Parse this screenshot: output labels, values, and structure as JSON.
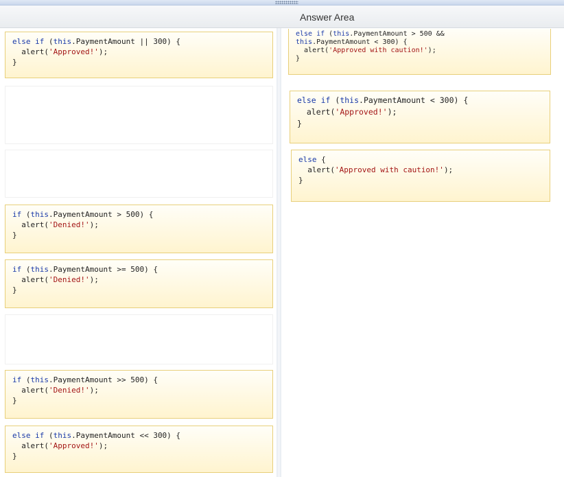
{
  "header": {
    "answer_area_title": "Answer Area"
  },
  "source_tiles": [
    {
      "l1_kw": "else if",
      "l1_pre": " (",
      "l1_this": "this",
      "l1_rest": ".PaymentAmount || 300) {",
      "l2_pre": "  alert(",
      "l2_str": "'Approved!'",
      "l2_post": ");",
      "l3": "}"
    },
    {
      "l1_kw": "if",
      "l1_pre": " (",
      "l1_this": "this",
      "l1_rest": ".PaymentAmount > 500) {",
      "l2_pre": "  alert(",
      "l2_str": "'Denied!'",
      "l2_post": ");",
      "l3": "}"
    },
    {
      "l1_kw": "if",
      "l1_pre": " (",
      "l1_this": "this",
      "l1_rest": ".PaymentAmount >= 500) {",
      "l2_pre": "  alert(",
      "l2_str": "'Denied!'",
      "l2_post": ");",
      "l3": "}"
    },
    {
      "l1_kw": "if",
      "l1_pre": " (",
      "l1_this": "this",
      "l1_rest": ".PaymentAmount >> 500) {",
      "l2_pre": "  alert(",
      "l2_str": "'Denied!'",
      "l2_post": ");",
      "l3": "}"
    },
    {
      "l1_kw": "else if",
      "l1_pre": " (",
      "l1_this": "this",
      "l1_rest": ".PaymentAmount << 300) {",
      "l2_pre": "  alert(",
      "l2_str": "'Approved!'",
      "l2_post": ");",
      "l3": "}"
    }
  ],
  "answer_tiles": [
    {
      "l1_kw": "else if",
      "l1_pre": " (",
      "l1_this": "this",
      "l1_rest": ".PaymentAmount > 500 &&",
      "l2_this": "this",
      "l2_rest": ".PaymentAmount < 300) {",
      "l3_pre": "  alert(",
      "l3_str": "'Approved with caution!'",
      "l3_post": ");",
      "l4": "}"
    },
    {
      "l1_kw": "else if",
      "l1_pre": " (",
      "l1_this": "this",
      "l1_rest": ".PaymentAmount < 300) {",
      "l2_pre": "  alert(",
      "l2_str": "'Approved!'",
      "l2_post": ");",
      "l3": "}"
    },
    {
      "l1_kw": "else",
      "l1_rest": " {",
      "l2_pre": "  alert(",
      "l2_str": "'Approved with caution!'",
      "l2_post": ");",
      "l3": "}"
    }
  ]
}
